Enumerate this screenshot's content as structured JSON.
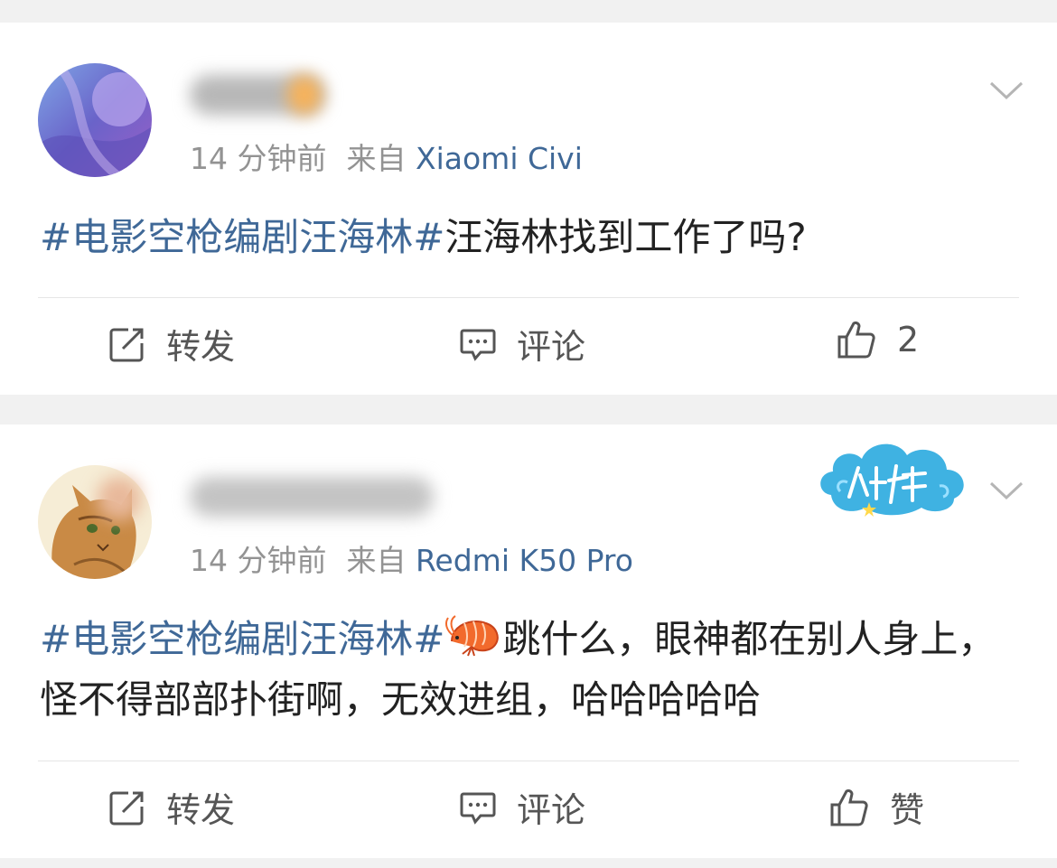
{
  "posts": [
    {
      "time": "14 分钟前",
      "from_label": "来自",
      "device": "Xiaomi Civi",
      "topic": "#电影空枪编剧汪海林#",
      "text": "汪海林找到工作了吗?",
      "actions": {
        "repost": "转发",
        "comment": "评论",
        "like": "2"
      }
    },
    {
      "time": "14 分钟前",
      "from_label": "来自",
      "device": "Redmi K50 Pro",
      "topic": "#电影空枪编剧汪海林#",
      "emoji": "shrimp-emoji",
      "text": "跳什么，眼神都在别人身上，怪不得部部扑街啊，无效进组，哈哈哈哈哈",
      "actions": {
        "repost": "转发",
        "comment": "评论",
        "like": "赞"
      }
    }
  ],
  "icons": {
    "repost": "repost-icon",
    "comment": "comment-icon",
    "like": "thumbs-up-icon",
    "menu": "chevron-down-icon"
  },
  "colors": {
    "background": "#f1f1f1",
    "card": "#ffffff",
    "link": "#3f6897",
    "meta": "#939393",
    "text": "#222222"
  }
}
